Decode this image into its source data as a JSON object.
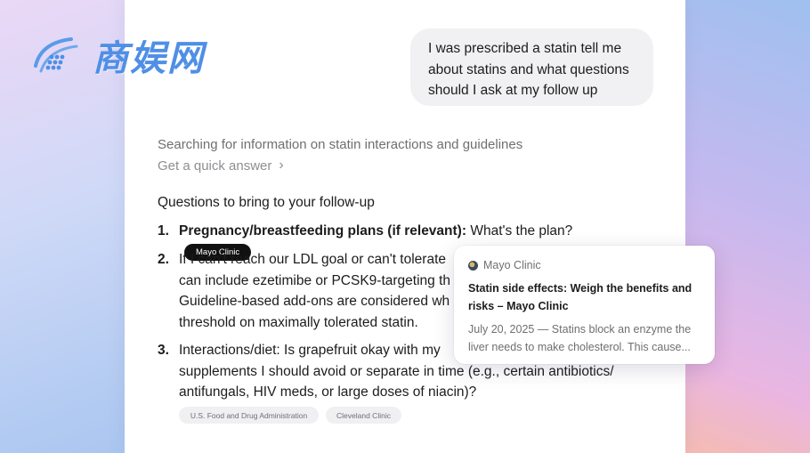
{
  "watermark": {
    "text": "商娱网"
  },
  "chat": {
    "user_message": "I was prescribed a statin tell me about statins and what questions should I ask at my follow up",
    "status": "Searching for information on statin interactions and guidelines",
    "quick_answer": "Get a quick answer",
    "heading": "Questions to bring to your follow-up",
    "items": [
      {
        "num": "1.",
        "bold": "Pregnancy/breastfeeding plans (if relevant):",
        "text": " What's the plan?",
        "citation": "Mayo Clinic"
      },
      {
        "num": "2.",
        "lines": [
          "If I can't reach our LDL goal or can't tolerate",
          "can include ezetimibe or PCSK9-targeting th",
          "Guideline-based add-ons are considered wh",
          "threshold on maximally tolerated statin."
        ]
      },
      {
        "num": "3.",
        "lines": [
          "Interactions/diet: Is grapefruit okay with my",
          "supplements I should avoid or separate in time (e.g., certain antibiotics/",
          "antifungals, HIV meds, or large doses of niacin)?"
        ]
      }
    ],
    "sources": [
      "U.S. Food and Drug Administration",
      "Cleveland Clinic"
    ]
  },
  "citation_card": {
    "source": "Mayo Clinic",
    "title": "Statin side effects: Weigh the benefits and risks – Mayo Clinic",
    "snippet": "July 20, 2025 — Statins block an enzyme the liver needs to make cholesterol. This cause..."
  },
  "colors": {
    "accent_logo": "#4f8fe6",
    "citation_pill": "#111111",
    "bubble": "#f1f1f3"
  }
}
